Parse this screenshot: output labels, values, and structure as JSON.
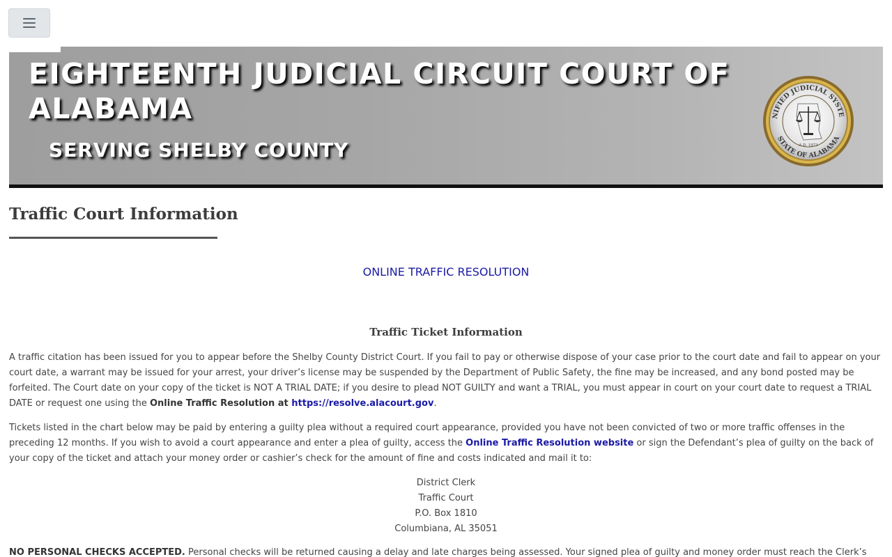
{
  "banner": {
    "title": "EIGHTEENTH JUDICIAL CIRCUIT COURT OF ALABAMA",
    "subtitle": "SERVING SHELBY COUNTY",
    "seal": {
      "text_top": "UNIFIED JUDICIAL SYSTEM",
      "text_bottom": "STATE OF ALABAMA",
      "text_center": "A.D. 1973"
    }
  },
  "page_title": "Traffic Court Information",
  "online_link": "ONLINE TRAFFIC RESOLUTION",
  "section_heading": "Traffic Ticket Information",
  "para1": {
    "text": "A traffic citation has been issued for you to appear before the Shelby County District Court. If you fail to pay or otherwise dispose of your case prior to the court date and fail to appear on your court date, a warrant may be issued for your arrest, your driver’s license may be suspended by the Department of Public Safety, the fine may be increased, and any bond posted may be forfeited. The Court date on your copy of the ticket is NOT A TRIAL DATE; if you desire to plead NOT GUILTY and want a TRIAL, you must appear in court on your court date to request a TRIAL DATE or request one using the ",
    "bold": "Online Traffic Resolution at ",
    "link": "https://resolve.alacourt.gov",
    "end": "."
  },
  "para2": {
    "text": "Tickets listed in the chart below may be paid by entering a guilty plea without a required court appearance, provided you have not been convicted of two or more traffic offenses in the preceding 12 months. If you wish to avoid a court appearance and enter a plea of guilty, access the ",
    "link": "Online Traffic Resolution website",
    "text2": " or sign the Defendant’s plea of guilty on the back of your copy of the ticket and attach your money order or cashier’s check for the amount of fine and costs indicated and mail it to:"
  },
  "address": [
    "District Clerk",
    "Traffic Court",
    "P.O. Box 1810",
    "Columbiana, AL 35051"
  ],
  "para3": {
    "bold": "NO PERSONAL CHECKS ACCEPTED.",
    "text": " Personal checks will be returned causing a delay and late charges being assessed. Your signed plea of guilty and money order must reach the Clerk’s office before your court date."
  },
  "colors": {
    "link": "#1a1aa6",
    "banner_text": "#ffffff",
    "banner_border": "#111111"
  },
  "icons": {
    "menu": "hamburger-icon",
    "seal": "unified-judicial-system-seal"
  }
}
